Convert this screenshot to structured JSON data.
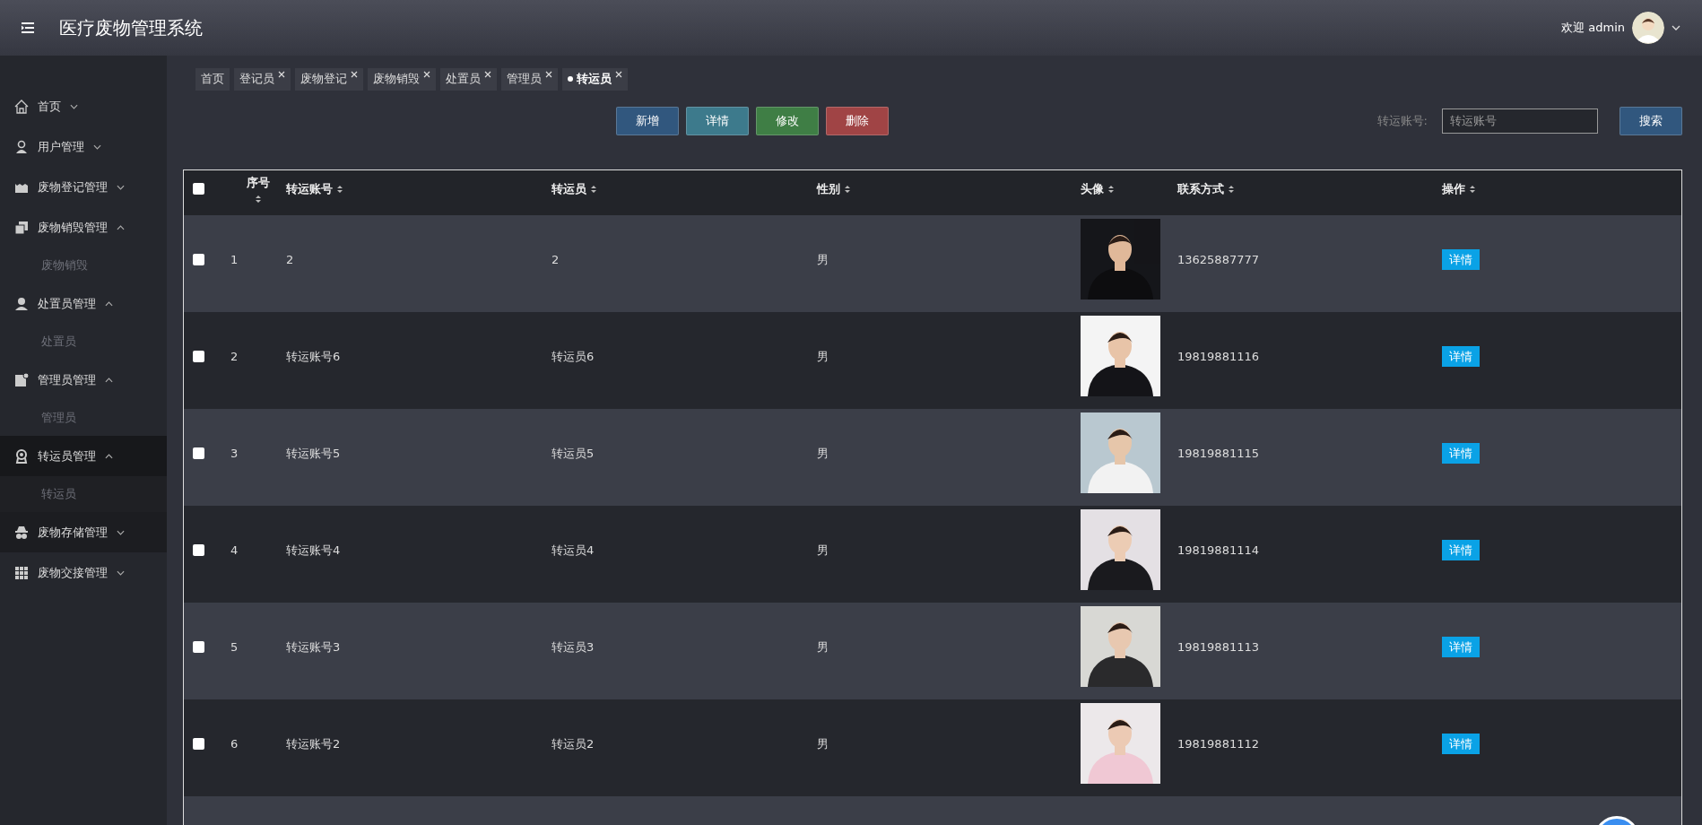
{
  "header": {
    "title": "医疗废物管理系统",
    "welcome": "欢迎 admin"
  },
  "sidebar": {
    "items": [
      {
        "label": "首页",
        "expanded": false,
        "selected": false,
        "hovered": false
      },
      {
        "label": "用户管理",
        "expanded": false,
        "selected": false,
        "hovered": false
      },
      {
        "label": "废物登记管理",
        "expanded": false,
        "selected": false,
        "hovered": false
      },
      {
        "label": "废物销毁管理",
        "expanded": true,
        "selected": false,
        "hovered": false,
        "children": [
          {
            "label": "废物销毁"
          }
        ]
      },
      {
        "label": "处置员管理",
        "expanded": true,
        "selected": false,
        "hovered": false,
        "children": [
          {
            "label": "处置员"
          }
        ]
      },
      {
        "label": "管理员管理",
        "expanded": true,
        "selected": false,
        "hovered": false,
        "children": [
          {
            "label": "管理员"
          }
        ]
      },
      {
        "label": "转运员管理",
        "expanded": true,
        "selected": true,
        "hovered": false,
        "children": [
          {
            "label": "转运员"
          }
        ]
      },
      {
        "label": "废物存储管理",
        "expanded": false,
        "selected": false,
        "hovered": true
      },
      {
        "label": "废物交接管理",
        "expanded": false,
        "selected": false,
        "hovered": false
      }
    ]
  },
  "tabs": [
    {
      "label": "首页",
      "selected": false,
      "closable": false
    },
    {
      "label": "登记员",
      "selected": false,
      "closable": true
    },
    {
      "label": "废物登记",
      "selected": false,
      "closable": true
    },
    {
      "label": "废物销毁",
      "selected": false,
      "closable": true
    },
    {
      "label": "处置员",
      "selected": false,
      "closable": true
    },
    {
      "label": "管理员",
      "selected": false,
      "closable": true
    },
    {
      "label": "转运员",
      "selected": true,
      "closable": true
    }
  ],
  "toolbar": {
    "buttons": [
      {
        "label": "新增",
        "kind": "add"
      },
      {
        "label": "详情",
        "kind": "detail"
      },
      {
        "label": "修改",
        "kind": "edit"
      },
      {
        "label": "删除",
        "kind": "delete"
      }
    ],
    "search_label": "转运账号:",
    "search": {
      "placeholder": "转运账号"
    },
    "search_button": "搜索"
  },
  "table": {
    "columns": [
      "序号",
      "转运账号",
      "转运员",
      "性别",
      "头像",
      "联系方式",
      "操作"
    ],
    "header_checked": false,
    "rows": [
      {
        "checked": false,
        "index": "1",
        "account": "2",
        "name": "2",
        "gender": "男",
        "phone": "13625887777",
        "action": "详情"
      },
      {
        "checked": false,
        "index": "2",
        "account": "转运账号6",
        "name": "转运员6",
        "gender": "男",
        "phone": "19819881116",
        "action": "详情"
      },
      {
        "checked": false,
        "index": "3",
        "account": "转运账号5",
        "name": "转运员5",
        "gender": "男",
        "phone": "19819881115",
        "action": "详情"
      },
      {
        "checked": false,
        "index": "4",
        "account": "转运账号4",
        "name": "转运员4",
        "gender": "男",
        "phone": "19819881114",
        "action": "详情"
      },
      {
        "checked": false,
        "index": "5",
        "account": "转运账号3",
        "name": "转运员3",
        "gender": "男",
        "phone": "19819881113",
        "action": "详情"
      },
      {
        "checked": false,
        "index": "6",
        "account": "转运账号2",
        "name": "转运员2",
        "gender": "男",
        "phone": "19819881112",
        "action": "详情"
      }
    ]
  }
}
